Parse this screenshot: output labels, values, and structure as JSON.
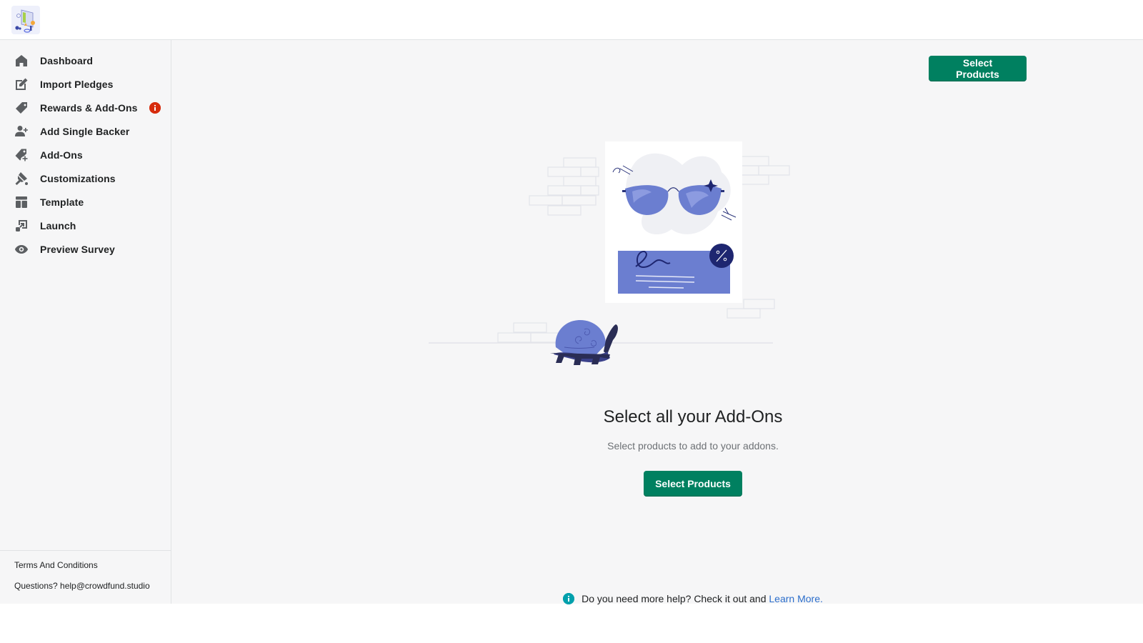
{
  "app": {
    "logo_alt": "Crowdfund Studio logo"
  },
  "sidebar": {
    "items": [
      {
        "label": "Dashboard",
        "icon": "home-icon"
      },
      {
        "label": "Import Pledges",
        "icon": "edit-icon"
      },
      {
        "label": "Rewards & Add-Ons",
        "icon": "tag-icon",
        "alert": true
      },
      {
        "label": "Add Single Backer",
        "icon": "add-user-icon"
      },
      {
        "label": "Add-Ons",
        "icon": "tag-plus-icon"
      },
      {
        "label": "Customizations",
        "icon": "paint-brush-icon"
      },
      {
        "label": "Template",
        "icon": "layout-icon"
      },
      {
        "label": "Launch",
        "icon": "external-launch-icon"
      },
      {
        "label": "Preview Survey",
        "icon": "eye-icon"
      }
    ],
    "footer": {
      "terms_label": "Terms And Conditions",
      "questions_label": "Questions? help@crowdfund.studio"
    }
  },
  "main": {
    "top_button_label": "Select Products",
    "empty_state": {
      "title": "Select all your Add-Ons",
      "subtitle": "Select products to add to your addons.",
      "button_label": "Select Products"
    },
    "help": {
      "text": "Do you need more help? Check it out and ",
      "link_label": "Learn More."
    }
  },
  "colors": {
    "primary": "#008060",
    "alert": "#d72c0d",
    "info": "#00a0ac",
    "link": "#2c6ecb",
    "illustration_accent": "#6b7ed0"
  }
}
